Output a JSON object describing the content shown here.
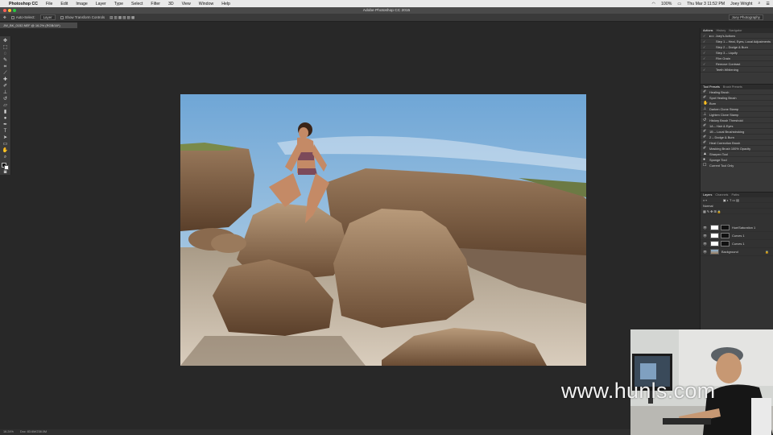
{
  "menubar": {
    "items": [
      "Photoshop CC",
      "File",
      "Edit",
      "Image",
      "Layer",
      "Type",
      "Select",
      "Filter",
      "3D",
      "View",
      "Window",
      "Help"
    ],
    "battery": "100%",
    "clock": "Thu Mar 3  11:52 PM",
    "user": "Joey Wright"
  },
  "window": {
    "title": "Adobe Photoshop CC 2015"
  },
  "options": {
    "auto_select_label": "Auto-Select:",
    "auto_select_value": "Layer",
    "transform_label": "Show Transform Controls",
    "workspace": "Joey Photography"
  },
  "document": {
    "tab": "JW_BK_0152.NEF @ 16.2% (RGB/16*)"
  },
  "status": {
    "zoom": "16.24%",
    "doc_size": "Doc: 83.6M/238.0M"
  },
  "panels": {
    "actions_tabs": [
      "Actions",
      "History",
      "Navigator"
    ],
    "actions": [
      {
        "check": "✓",
        "label": "Joey's Actions"
      },
      {
        "check": "✓",
        "label": "Step 1 – Heal, Eyes, Local Adjustments"
      },
      {
        "check": "✓",
        "label": "Step 2 – Dodge & Burn"
      },
      {
        "check": "✓",
        "label": "Step 3 – Liquify"
      },
      {
        "check": "✓",
        "label": "Film Grain"
      },
      {
        "check": "✓",
        "label": "Remove Contrast"
      },
      {
        "check": "✓",
        "label": "Teeth Whitening"
      }
    ],
    "presets_tabs": [
      "Tool Presets",
      "Brush Presets"
    ],
    "presets": [
      "Healing Brush",
      "Spot Healing Brush",
      "Burn",
      "Darken Clone Stamp",
      "Lighten Clone Stamp",
      "History Brush Threshold",
      "1A – Hair & Eyes",
      "1B – Local Brushstroking",
      "2 – Dodge & Burn",
      "Heal Correction Brush",
      "Masking Brush 100% Opacity",
      "Sharpen Tool",
      "Sponge Tool"
    ],
    "current_tool_only": "Current Tool Only",
    "layers_tabs": [
      "Layers",
      "Channels",
      "Paths"
    ],
    "layers_mode": "Normal",
    "layers": [
      {
        "name": "Hue/Saturation 1"
      },
      {
        "name": "Curves 1"
      },
      {
        "name": "Curves 1"
      },
      {
        "name": "Background"
      }
    ]
  },
  "watermark": "www.hunls.com"
}
